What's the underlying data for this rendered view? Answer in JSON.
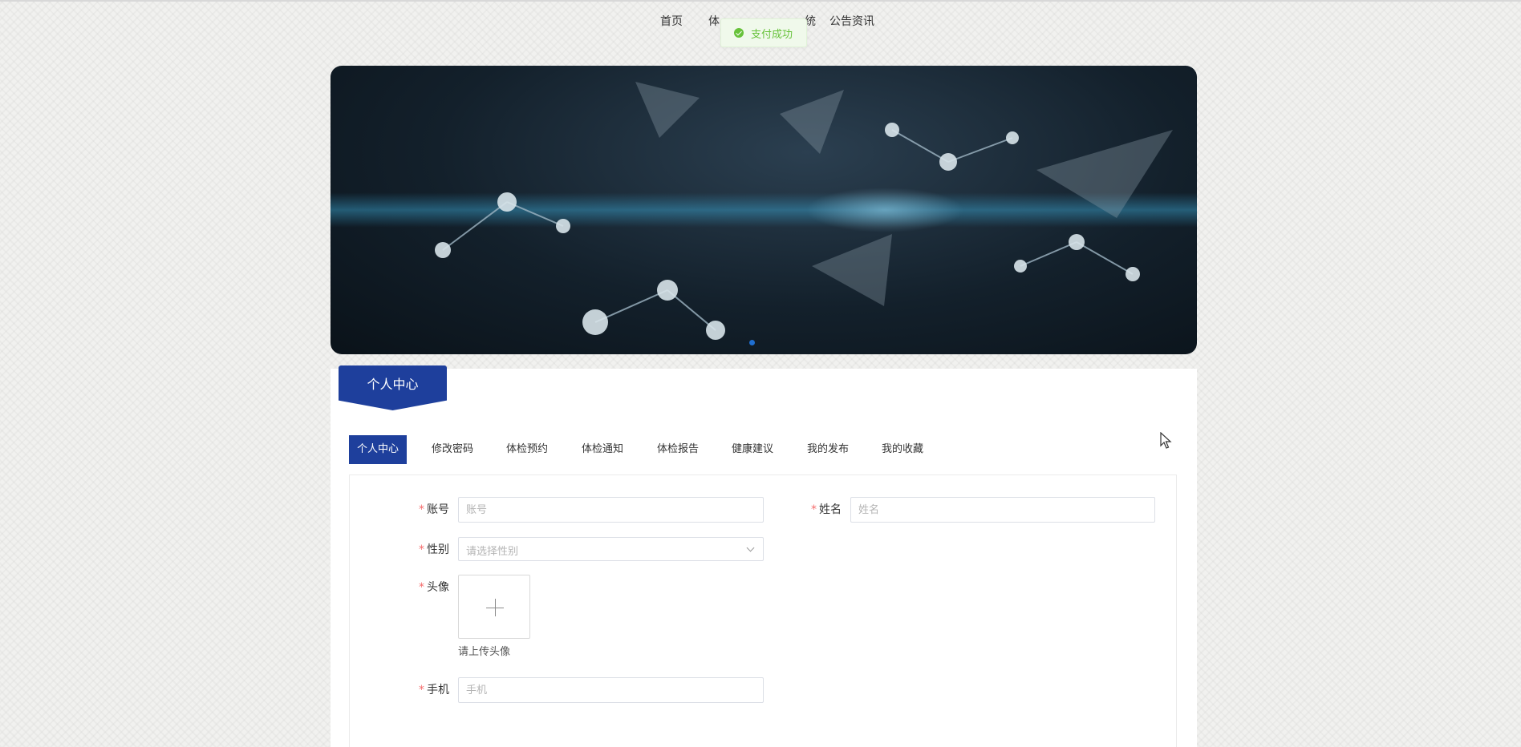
{
  "nav": {
    "home": "首页",
    "partial_left": "体",
    "partial_right": "统",
    "news": "公告资讯"
  },
  "toast": {
    "icon": "check-circle-icon",
    "text": "支付成功",
    "color": "#67c23a"
  },
  "banner": {
    "active_slide": 1
  },
  "section": {
    "title": "个人中心",
    "accent": "#1e3f9c"
  },
  "tabs": [
    {
      "label": "个人中心",
      "active": true
    },
    {
      "label": "修改密码"
    },
    {
      "label": "体检预约"
    },
    {
      "label": "体检通知"
    },
    {
      "label": "体检报告"
    },
    {
      "label": "健康建议"
    },
    {
      "label": "我的发布"
    },
    {
      "label": "我的收藏"
    }
  ],
  "form": {
    "required_mark": "*",
    "account": {
      "label": "账号",
      "placeholder": "账号",
      "value": ""
    },
    "name": {
      "label": "姓名",
      "placeholder": "姓名",
      "value": ""
    },
    "gender": {
      "label": "性别",
      "placeholder": "请选择性别"
    },
    "avatar": {
      "label": "头像",
      "tip": "请上传头像",
      "icon": "plus-icon"
    },
    "phone": {
      "label": "手机",
      "placeholder": "手机",
      "value": ""
    }
  }
}
